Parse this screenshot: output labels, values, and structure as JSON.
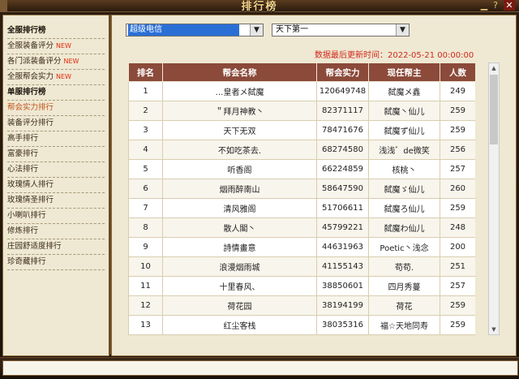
{
  "window": {
    "title": "排行榜",
    "icons": {
      "minimize": "minimize-icon",
      "help": "help-icon",
      "close": "close-icon"
    }
  },
  "sidebar": {
    "items": [
      {
        "label": "全服排行榜",
        "new": "",
        "bold": true,
        "active": false
      },
      {
        "label": "全服装备评分",
        "new": "NEW",
        "bold": false,
        "active": false
      },
      {
        "label": "各门派装备评分",
        "new": "NEW",
        "bold": false,
        "active": false
      },
      {
        "label": "全服帮会实力",
        "new": "NEW",
        "bold": false,
        "active": false
      },
      {
        "label": "单服排行榜",
        "new": "",
        "bold": true,
        "active": false
      },
      {
        "label": "帮会实力排行",
        "new": "",
        "bold": false,
        "active": true
      },
      {
        "label": "装备评分排行",
        "new": "",
        "bold": false,
        "active": false
      },
      {
        "label": "高手排行",
        "new": "",
        "bold": false,
        "active": false
      },
      {
        "label": "富豪排行",
        "new": "",
        "bold": false,
        "active": false
      },
      {
        "label": "心法排行",
        "new": "",
        "bold": false,
        "active": false
      },
      {
        "label": "玫瑰情人排行",
        "new": "",
        "bold": false,
        "active": false
      },
      {
        "label": "玫瑰情圣排行",
        "new": "",
        "bold": false,
        "active": false
      },
      {
        "label": "小喇叭排行",
        "new": "",
        "bold": false,
        "active": false
      },
      {
        "label": "修炼排行",
        "new": "",
        "bold": false,
        "active": false
      },
      {
        "label": "庄园舒适度排行",
        "new": "",
        "bold": false,
        "active": false
      },
      {
        "label": "珍奇藏排行",
        "new": "",
        "bold": false,
        "active": false
      }
    ]
  },
  "filters": {
    "server": "超级电信",
    "rank": "天下第一"
  },
  "update_label": "数据最后更新时间：2022-05-21 00:00:00",
  "table": {
    "headers": [
      "排名",
      "帮会名称",
      "帮会实力",
      "现任帮主",
      "人数"
    ],
    "rows": [
      [
        "1",
        "…皇者メ弑魔",
        "120649748",
        "弑魔メ鑫",
        "249"
      ],
      [
        "2",
        "＂拜月神教丶",
        "82371117",
        "弑魔丶仙儿",
        "259"
      ],
      [
        "3",
        "天下无双",
        "78471676",
        "弑魔ず仙儿",
        "259"
      ],
      [
        "4",
        "不如吃茶去.",
        "68274580",
        "浅浅゛de微笑",
        "256"
      ],
      [
        "5",
        "听香阁",
        "66224859",
        "核桃丶",
        "257"
      ],
      [
        "6",
        "烟雨醉南山",
        "58647590",
        "弑魔ゞ仙儿",
        "260"
      ],
      [
        "7",
        "清风雅阁",
        "51706611",
        "弑魔ろ仙儿",
        "259"
      ],
      [
        "8",
        "散人閣丶",
        "45799221",
        "弑魔わ仙儿",
        "248"
      ],
      [
        "9",
        "詩情畫意",
        "44631963",
        "Poetic丶浅念",
        "200"
      ],
      [
        "10",
        "浪漫烟雨城",
        "41155143",
        "苟苟.",
        "251"
      ],
      [
        "11",
        "十里春风、",
        "38850601",
        "四月秀蔓",
        "257"
      ],
      [
        "12",
        "荷花园",
        "38194199",
        "荷花",
        "259"
      ],
      [
        "13",
        "红尘客栈",
        "38035316",
        "福☆天地同寿",
        "259"
      ]
    ]
  },
  "colors": {
    "header_bg": "#8b4a3a",
    "panel_bg": "#efe8d2",
    "update_text": "#d0281a",
    "new_badge": "#e02a10",
    "active_item": "#c0541a"
  }
}
